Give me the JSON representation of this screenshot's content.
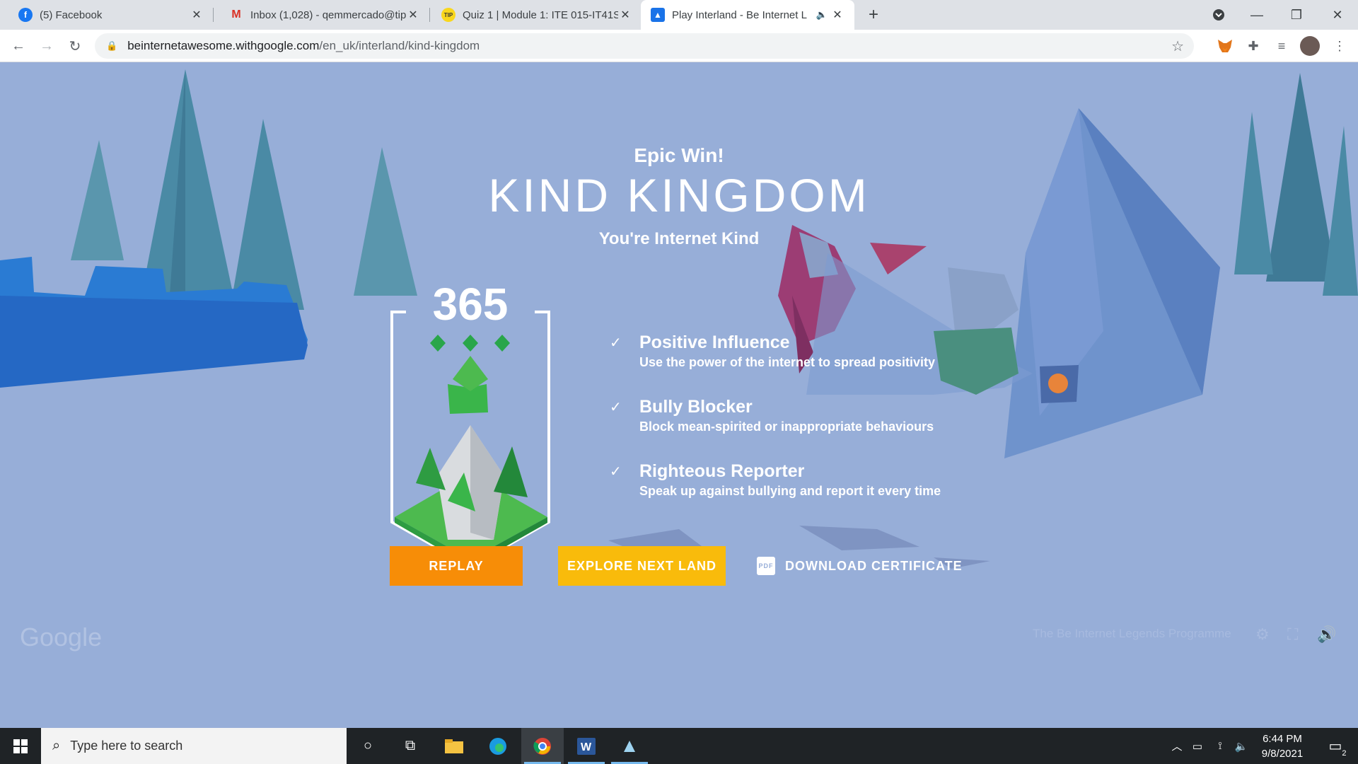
{
  "browser": {
    "tabs": [
      {
        "title": "(5) Facebook",
        "icon": "facebook-icon",
        "active": false
      },
      {
        "title": "Inbox (1,028) - qemmercado@tip",
        "icon": "gmail-icon",
        "active": false
      },
      {
        "title": "Quiz 1 | Module 1: ITE 015-IT41S",
        "icon": "tip-icon",
        "active": false
      },
      {
        "title": "Play Interland - Be Internet L",
        "icon": "interland-icon",
        "active": true
      }
    ],
    "new_tab_label": "+",
    "url_host": "beinternetawesome.withgoogle.com",
    "url_path": "/en_uk/interland/kind-kingdom"
  },
  "game": {
    "epic": "Epic Win!",
    "title": "KIND KINGDOM",
    "subtitle": "You're Internet Kind",
    "score": "365",
    "gems": 3,
    "achievements": [
      {
        "name": "Positive Influence",
        "desc": "Use the power of the internet to spread positivity"
      },
      {
        "name": "Bully Blocker",
        "desc": "Block mean-spirited or inappropriate behaviours"
      },
      {
        "name": "Righteous Reporter",
        "desc": "Speak up against bullying and report it every time"
      }
    ],
    "buttons": {
      "replay": "REPLAY",
      "explore": "EXPLORE NEXT LAND",
      "certificate": "DOWNLOAD CERTIFICATE",
      "pdf_badge": "PDF"
    },
    "footer": {
      "google": "Google",
      "programme": "The Be Internet Legends Programme"
    },
    "colors": {
      "sky": "#97aed8",
      "replay": "#f78d07",
      "explore": "#f9bb0b"
    }
  },
  "taskbar": {
    "search_placeholder": "Type here to search",
    "time": "6:44 PM",
    "date": "9/8/2021",
    "notification_count": "2"
  }
}
